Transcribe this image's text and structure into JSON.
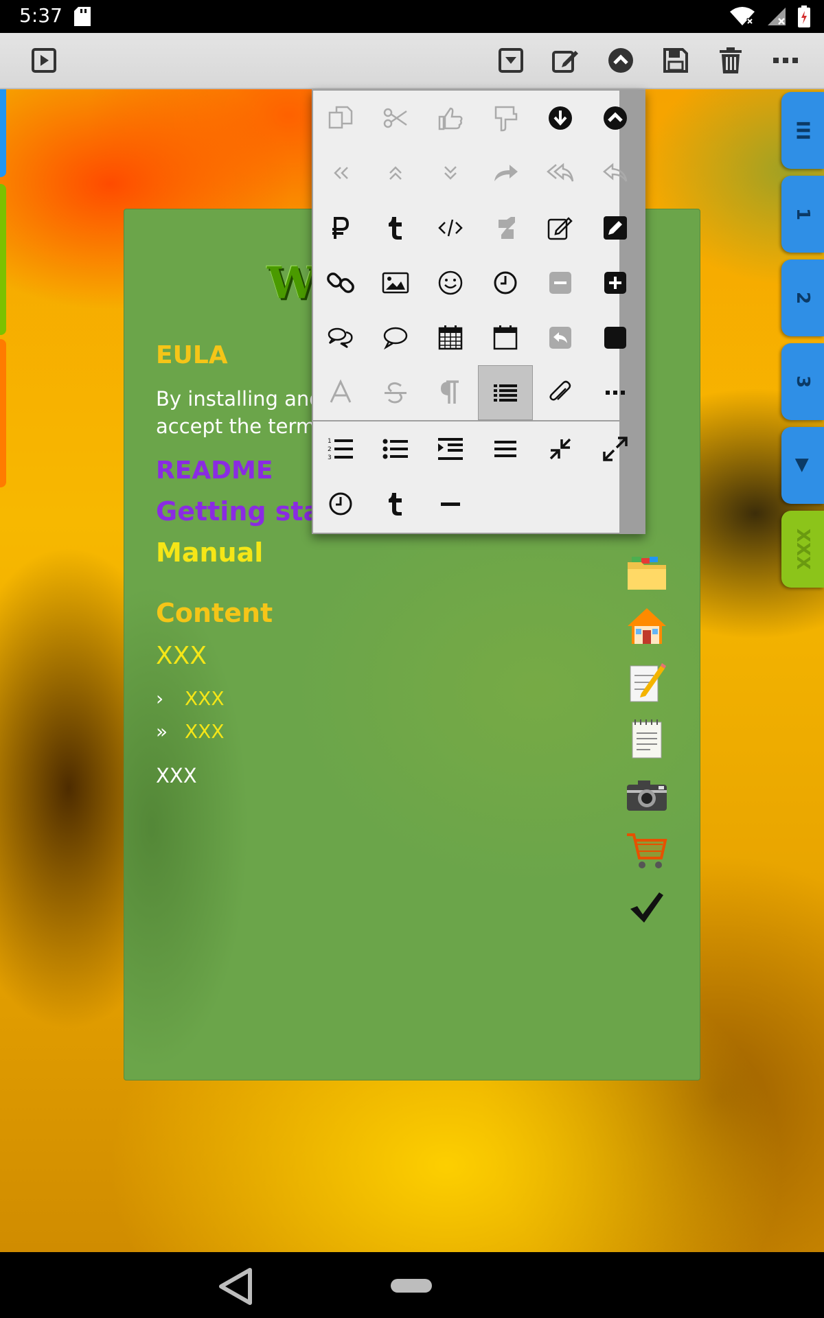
{
  "status_bar": {
    "time": "5:37"
  },
  "toolbar": {
    "left_button": "play-in-box-icon",
    "buttons": [
      "dropdown-box-icon",
      "edit-icon",
      "chevron-up-circle-icon",
      "save-icon",
      "trash-icon",
      "more-horizontal-icon"
    ]
  },
  "note": {
    "title": "W",
    "eula_heading": "EULA",
    "eula_text_line1": "By installing and",
    "eula_text_line2": "accept the term",
    "readme_link": "README",
    "getting_started_link": "Getting start",
    "manual_link": "Manual",
    "content_heading": "Content",
    "item_1": "XXX",
    "item_2": "XXX",
    "item_3": "XXX",
    "item_4": "XXX",
    "bullet_single": "›",
    "bullet_double": "»"
  },
  "right_tabs": [
    {
      "label": "III",
      "color": "#2f8fe6"
    },
    {
      "label": "1",
      "color": "#2f8fe6"
    },
    {
      "label": "2",
      "color": "#2f8fe6"
    },
    {
      "label": "3",
      "color": "#2f8fe6"
    },
    {
      "label": "▶",
      "color": "#2f8fe6"
    },
    {
      "label": "XXX",
      "color": "#8cc41a"
    }
  ],
  "side_emojis": [
    "folder-emoji",
    "house-emoji",
    "memo-emoji",
    "notepad-emoji",
    "camera-emoji",
    "shopping-cart-emoji",
    "check-mark-emoji"
  ],
  "palette": {
    "selected_index": 33,
    "icons": [
      "copy-icon",
      "cut-icon",
      "thumbs-up-icon",
      "paste-icon",
      "arrow-down-circle-icon",
      "arrow-up-circle-icon",
      "double-left-icon",
      "double-up-icon",
      "double-down-icon",
      "redo-icon",
      "reply-all-icon",
      "undo-icon",
      "ruble-icon",
      "tumblr-icon",
      "code-icon",
      "deviantart-icon",
      "edit-square-icon",
      "pencil-square-icon",
      "link-icon",
      "image-icon",
      "smiley-icon",
      "clock-icon",
      "minus-square-icon",
      "plus-square-icon",
      "comments-icon",
      "comment-icon",
      "calendar-icon",
      "calendar-blank-icon",
      "share-square-icon",
      "stop-square-icon",
      "font-icon",
      "strikethrough-icon",
      "pilcrow-icon",
      "list-icon",
      "paperclip-icon",
      "ellipsis-icon",
      "ordered-list-icon",
      "bulleted-list-icon",
      "indent-icon",
      "align-justify-icon",
      "compress-icon",
      "expand-icon",
      "clock-icon",
      "tumblr-icon",
      "horizontal-rule-icon"
    ]
  },
  "colors": {
    "toolbar_bg": "#dedede",
    "note_bg": "#6ba54a",
    "popup_bg": "#eeeeee",
    "accent_blue": "#2f8fe6",
    "accent_green": "#8cc41a"
  }
}
